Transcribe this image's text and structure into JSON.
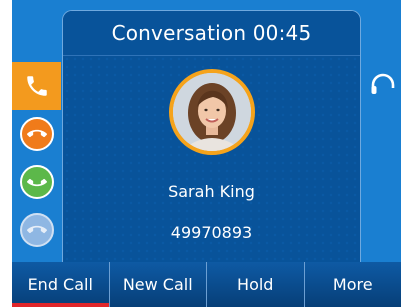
{
  "conversation": {
    "title": "Conversation 00:45"
  },
  "caller": {
    "name": "Sarah King",
    "number": "49970893"
  },
  "line_keys": [
    {
      "icon": "phone-handset-icon",
      "state": "active",
      "color": "#f39a1e"
    },
    {
      "icon": "hangup-icon",
      "state": "end",
      "color": "#f07b1a"
    },
    {
      "icon": "answer-icon",
      "state": "answer",
      "color": "#5cb84a"
    },
    {
      "icon": "hangup-icon",
      "state": "disabled",
      "color": "#8fb7e3"
    }
  ],
  "softkeys": [
    {
      "label": "End Call",
      "accent": "#e0262a"
    },
    {
      "label": "New Call"
    },
    {
      "label": "Hold"
    },
    {
      "label": "More"
    }
  ],
  "colors": {
    "panel": "#08539a",
    "background": "#1a7fd1",
    "avatar_ring": "#f5a31b"
  }
}
